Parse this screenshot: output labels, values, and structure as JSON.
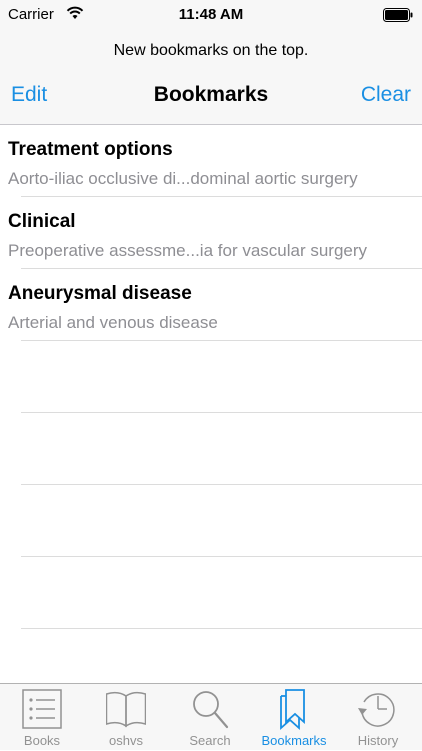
{
  "status_bar": {
    "carrier": "Carrier",
    "time": "11:48 AM"
  },
  "prompt": "New bookmarks on the top.",
  "nav": {
    "edit": "Edit",
    "title": "Bookmarks",
    "clear": "Clear"
  },
  "bookmarks": [
    {
      "title": "Treatment options",
      "subtitle": "Aorto-iliac occlusive di...dominal aortic surgery"
    },
    {
      "title": "Clinical",
      "subtitle": "Preoperative assessme...ia for vascular surgery"
    },
    {
      "title": "Aneurysmal disease",
      "subtitle": "Arterial and venous disease"
    }
  ],
  "tabs": [
    {
      "label": "Books",
      "icon": "books-list-icon"
    },
    {
      "label": "oshvs",
      "icon": "open-book-icon"
    },
    {
      "label": "Search",
      "icon": "magnifier-icon"
    },
    {
      "label": "Bookmarks",
      "icon": "bookmarks-icon",
      "selected": true
    },
    {
      "label": "History",
      "icon": "clock-history-icon"
    }
  ],
  "colors": {
    "accent": "#1a8fe3",
    "inactive": "#929292",
    "bar_bg": "#f7f7f7"
  }
}
